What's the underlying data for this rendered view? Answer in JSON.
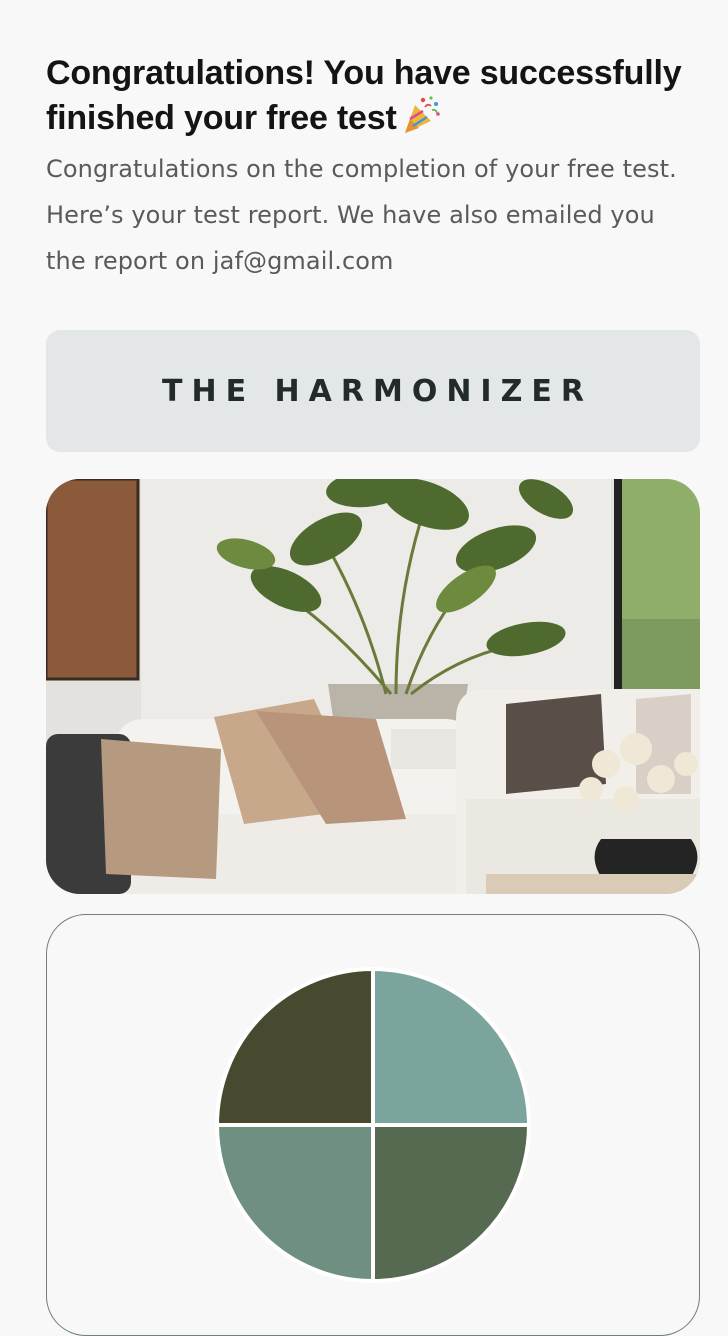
{
  "header": {
    "title": "Congratulations! You have successfully finished your free test",
    "title_emoji": "party-popper-icon",
    "subtitle": "Congratulations on the completion of your free test. Here’s your test report. We have also emailed you the report on jaf@gmail.com"
  },
  "result": {
    "personality_name": "THE HARMONIZER"
  },
  "image": {
    "subject": "living-room-photo"
  },
  "chart_data": {
    "type": "pie",
    "title": "",
    "values": [
      25,
      25,
      25,
      25
    ],
    "colors": [
      "#7ba59c",
      "#566a52",
      "#6f8f80",
      "#474a2f"
    ]
  }
}
